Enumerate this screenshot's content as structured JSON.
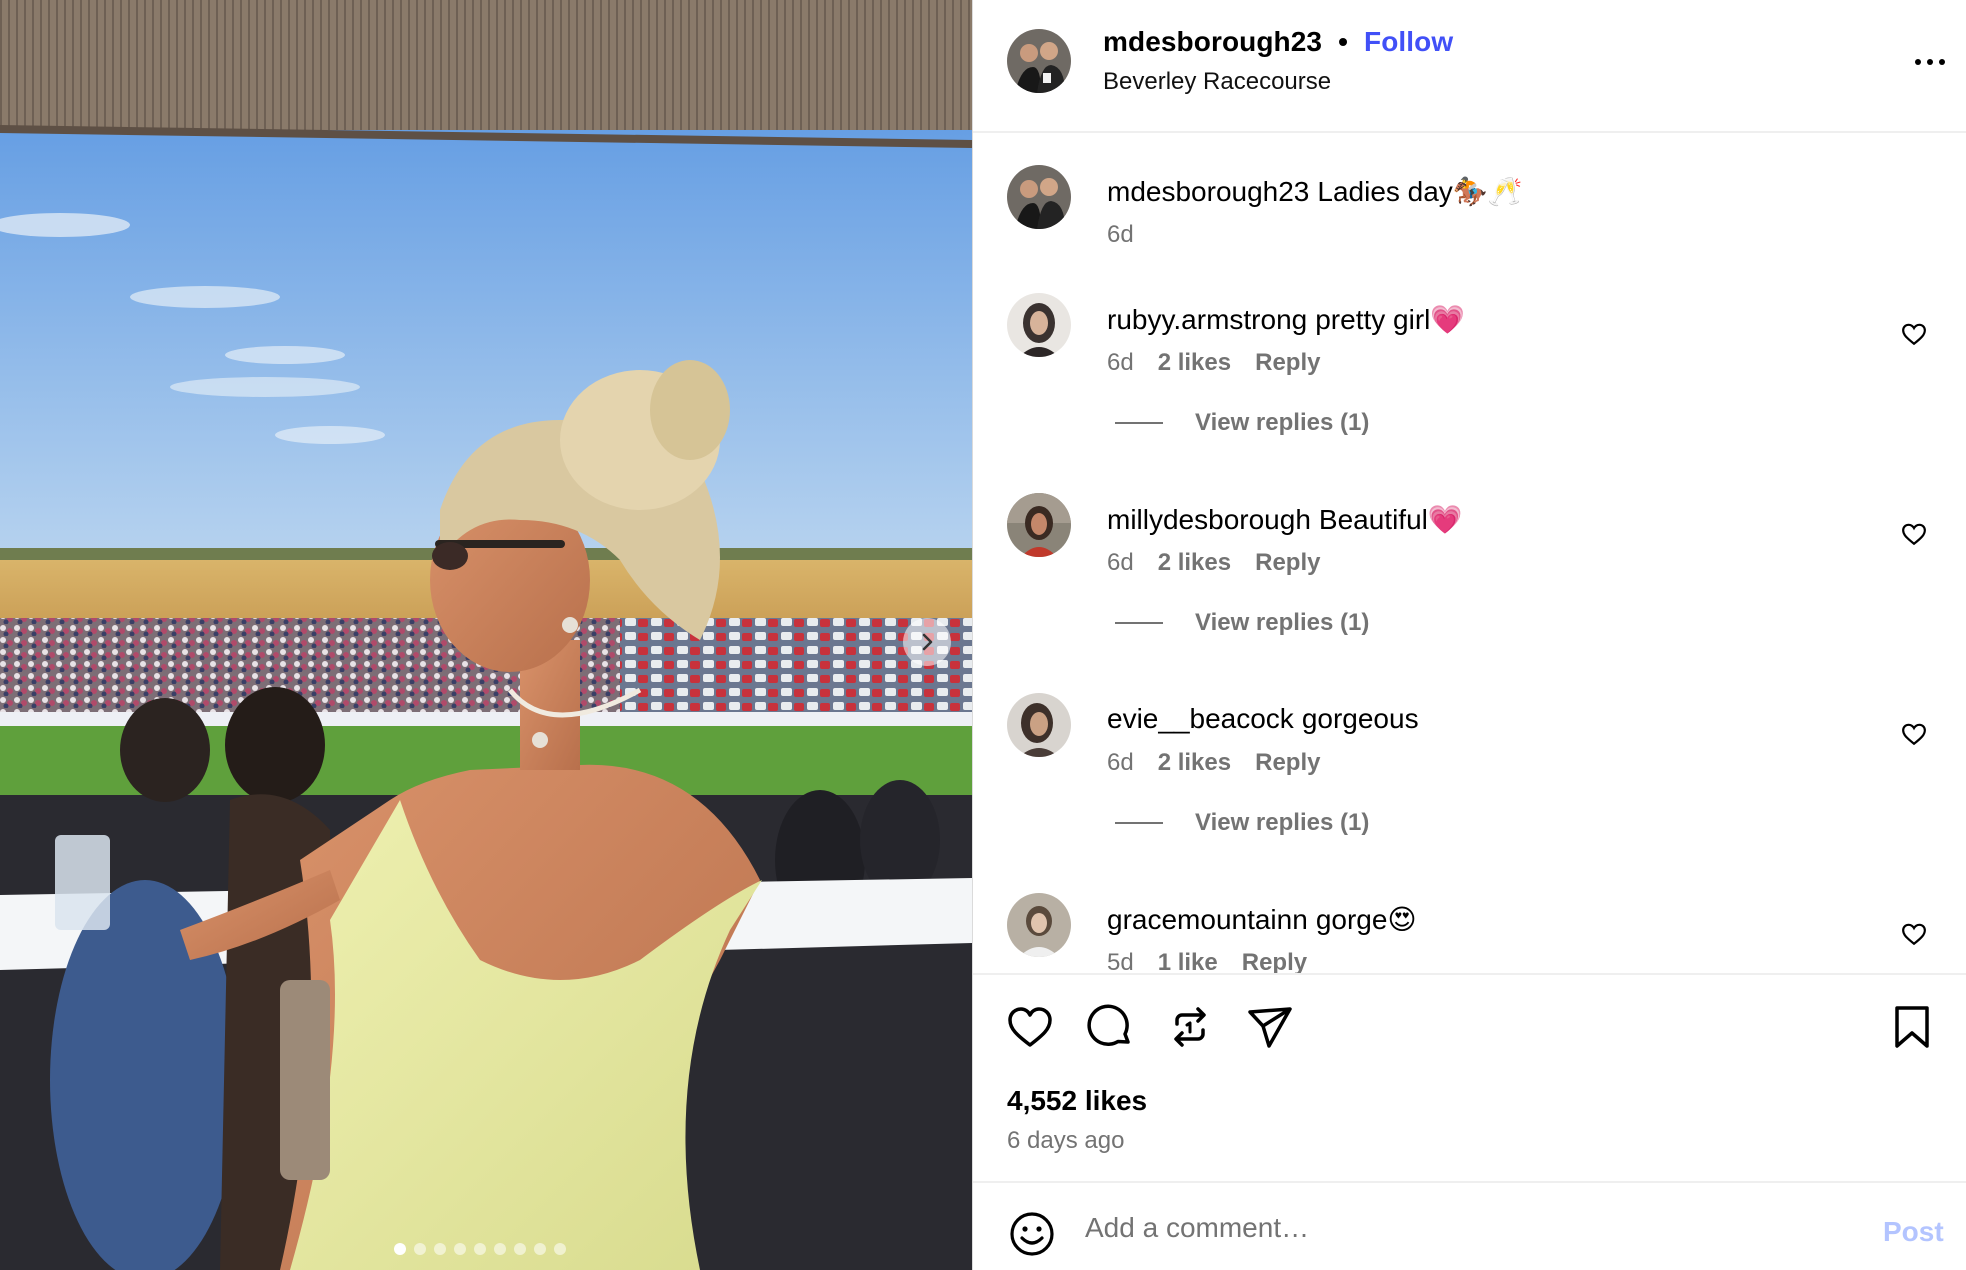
{
  "post": {
    "username": "mdesborough23",
    "separator": "•",
    "follow_label": "Follow",
    "location": "Beverley Racecourse",
    "more_icon": "more-horizontal-icon"
  },
  "carousel": {
    "slide_count": 9,
    "active_index": 0,
    "next_icon": "chevron-right-icon"
  },
  "caption": {
    "username": "mdesborough23",
    "text": "Ladies day🏇🥂",
    "time": "6d"
  },
  "comments": [
    {
      "username": "rubyy.armstrong",
      "text": "pretty girl💗",
      "time": "6d",
      "likes": "2 likes",
      "reply": "Reply",
      "view_replies": "View replies (1)",
      "avatar_color": "#3a3230"
    },
    {
      "username": "millydesborough",
      "text": "Beautiful💗",
      "time": "6d",
      "likes": "2 likes",
      "reply": "Reply",
      "view_replies": "View replies (1)",
      "avatar_color": "#7a5a48"
    },
    {
      "username": "evie__beacock",
      "text": "gorgeous",
      "time": "6d",
      "likes": "2 likes",
      "reply": "Reply",
      "view_replies": "View replies (1)",
      "avatar_color": "#4a3d38"
    },
    {
      "username": "gracemountainn",
      "text": "gorge😍",
      "time": "5d",
      "likes": "1 like",
      "reply": "Reply",
      "view_replies": "",
      "avatar_color": "#8e857a"
    }
  ],
  "actions": {
    "like_icon": "heart-icon",
    "comment_icon": "comment-icon",
    "repost_icon": "repost-icon",
    "share_icon": "send-icon",
    "save_icon": "bookmark-icon"
  },
  "likes_count": "4,552 likes",
  "posted_ago": "6 days ago",
  "add_comment": {
    "placeholder": "Add a comment…",
    "post_label": "Post",
    "emoji_icon": "smiley-icon"
  },
  "colors": {
    "follow": "#4150f7",
    "post_disabled": "#b3c4ff",
    "meta_gray": "#737373"
  }
}
